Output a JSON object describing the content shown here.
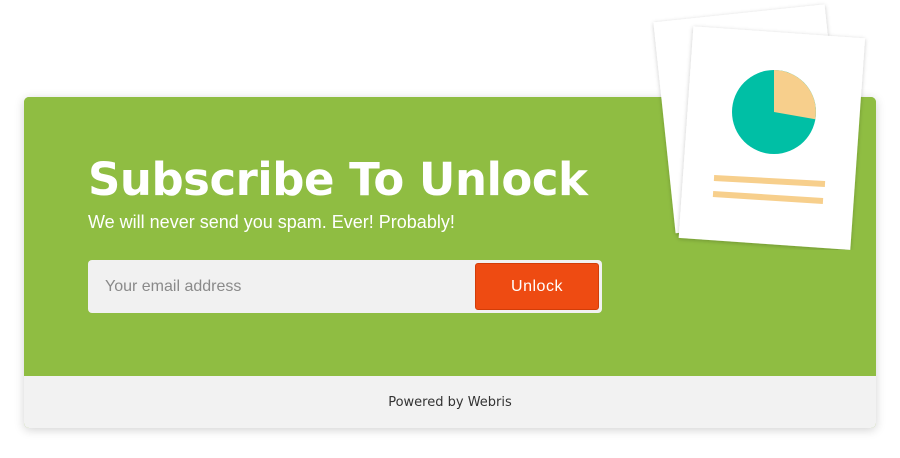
{
  "optin": {
    "title": "Subscribe To Unlock",
    "subtitle": "We will never send you spam. Ever! Probably!",
    "email_placeholder": "Your email address",
    "button_label": "Unlock",
    "footer_text": "Powered by Webris"
  },
  "illustration": {
    "icon": "report-document-icon",
    "pie_share_highlight": 0.25
  },
  "colors": {
    "panel_green": "#8fbd42",
    "button_orange": "#ee4b12",
    "footer_gray": "#f2f2f2",
    "pie_teal": "#00bfa5",
    "pie_peach": "#f7cf8c"
  }
}
